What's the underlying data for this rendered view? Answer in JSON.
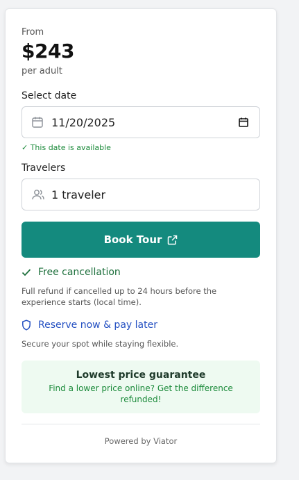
{
  "pricing": {
    "from_label": "From",
    "price": "$243",
    "unit": "per adult"
  },
  "date": {
    "label": "Select date",
    "value": "11/20/2025",
    "status": "✓ This date is available"
  },
  "travelers": {
    "label": "Travelers",
    "value": "1 traveler"
  },
  "book_button": {
    "label": "Book Tour"
  },
  "features": [
    {
      "title": "Free cancellation",
      "description": "Full refund if cancelled up to 24 hours before the experience starts (local time).",
      "icon": "check-icon"
    },
    {
      "title": "Reserve now & pay later",
      "description": "Secure your spot while staying flexible.",
      "icon": "shield-icon"
    }
  ],
  "guarantee": {
    "title": "Lowest price guarantee",
    "description": "Find a lower price online? Get the difference refunded!"
  },
  "footer": {
    "powered_by": "Powered by Viator"
  },
  "colors": {
    "accent": "#148a7e",
    "success": "#1b8a3a",
    "link": "#2450c2",
    "guarantee_bg": "#eefaf1"
  }
}
